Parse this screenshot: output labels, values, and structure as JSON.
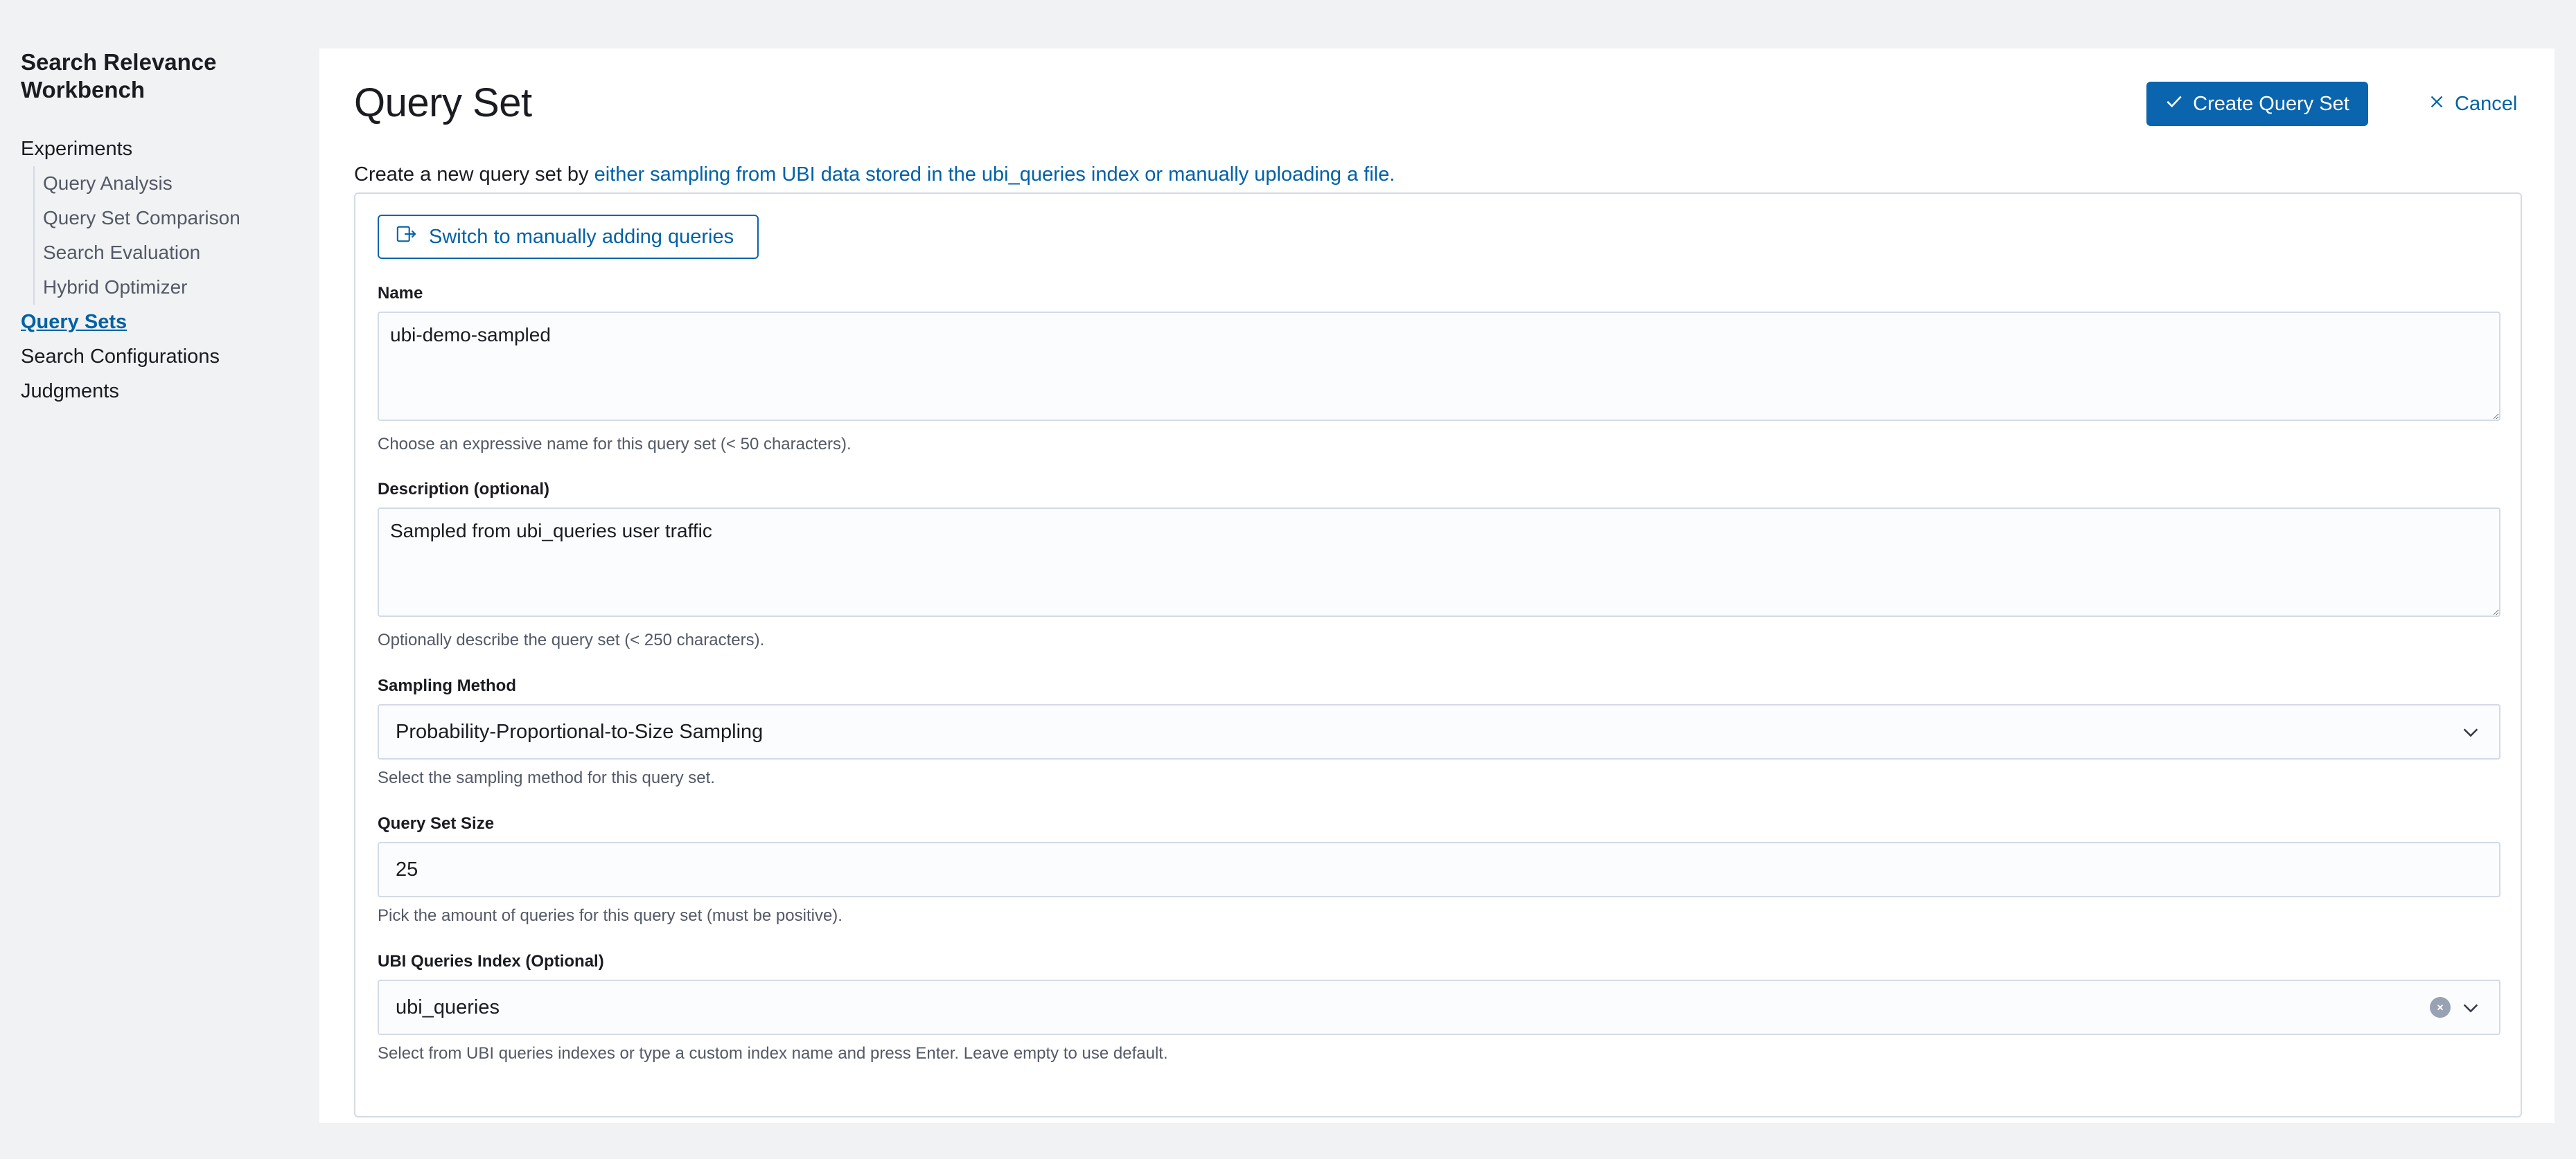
{
  "sidebar": {
    "app_title": "Search Relevance Workbench",
    "items": [
      {
        "label": "Experiments"
      },
      {
        "label": "Query Sets"
      },
      {
        "label": "Search Configurations"
      },
      {
        "label": "Judgments"
      }
    ],
    "sub_items": [
      {
        "label": "Query Analysis"
      },
      {
        "label": "Query Set Comparison"
      },
      {
        "label": "Search Evaluation"
      },
      {
        "label": "Hybrid Optimizer"
      }
    ]
  },
  "header": {
    "title": "Query Set",
    "create_label": "Create Query Set",
    "cancel_label": "Cancel"
  },
  "intro": {
    "prefix": "Create a new query set by ",
    "link": "either sampling from UBI data stored in the ubi_queries index or manually uploading a file."
  },
  "form": {
    "switch_label": "Switch to manually adding queries",
    "name": {
      "label": "Name",
      "value": "ubi-demo-sampled",
      "help": "Choose an expressive name for this query set (< 50 characters)."
    },
    "description": {
      "label": "Description (optional)",
      "value": "Sampled from ubi_queries user traffic",
      "help": "Optionally describe the query set (< 250 characters)."
    },
    "sampling": {
      "label": "Sampling Method",
      "value": "Probability-Proportional-to-Size Sampling",
      "help": "Select the sampling method for this query set."
    },
    "size": {
      "label": "Query Set Size",
      "value": "25",
      "help": "Pick the amount of queries for this query set (must be positive)."
    },
    "index": {
      "label": "UBI Queries Index (Optional)",
      "value": "ubi_queries",
      "help": "Select from UBI queries indexes or type a custom index name and press Enter. Leave empty to use default."
    }
  },
  "colors": {
    "accent": "#0b64ae",
    "link": "#0061a6",
    "background": "#f1f2f3"
  }
}
